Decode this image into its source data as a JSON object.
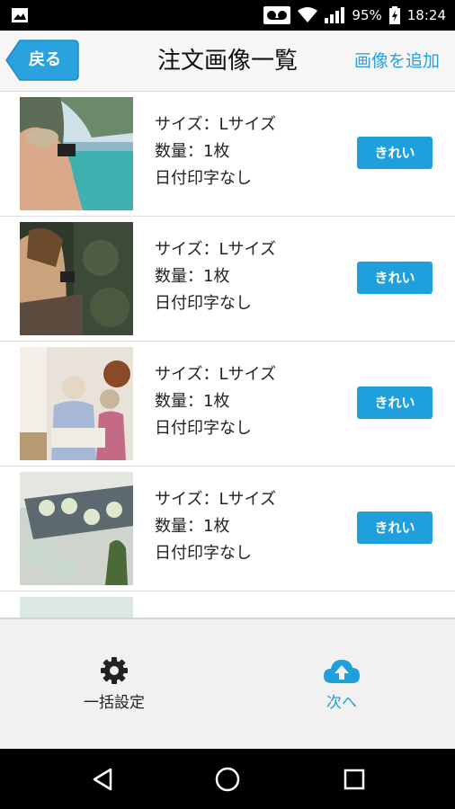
{
  "status_bar": {
    "battery_percent": "95%",
    "time": "18:24",
    "icons": [
      "image-icon",
      "voicemail-icon",
      "wifi-icon",
      "signal-icon",
      "battery-charging-icon"
    ]
  },
  "header": {
    "back_label": "戻る",
    "title": "注文画像一覧",
    "add_label": "画像を追加"
  },
  "items": [
    {
      "size": "サイズ：Lサイズ",
      "quantity": "数量：1枚",
      "date_print": "日付印字なし",
      "quality": "きれい",
      "image": "woman-photographing-lagoon"
    },
    {
      "size": "サイズ：Lサイズ",
      "quantity": "数量：1枚",
      "date_print": "日付印字なし",
      "quality": "きれい",
      "image": "girl-photographing-plants"
    },
    {
      "size": "サイズ：Lサイズ",
      "quantity": "数量：1枚",
      "date_print": "日付印字なし",
      "quality": "きれい",
      "image": "family-reading-album"
    },
    {
      "size": "サイズ：Lサイズ",
      "quantity": "数量：1枚",
      "date_print": "日付印字なし",
      "quality": "きれい",
      "image": "tea-set-on-tray"
    }
  ],
  "bottom_bar": {
    "settings_label": "一括設定",
    "next_label": "次へ"
  },
  "colors": {
    "accent": "#1f9fdc",
    "link": "#2aa2df",
    "back_button": "#2aa2df"
  }
}
